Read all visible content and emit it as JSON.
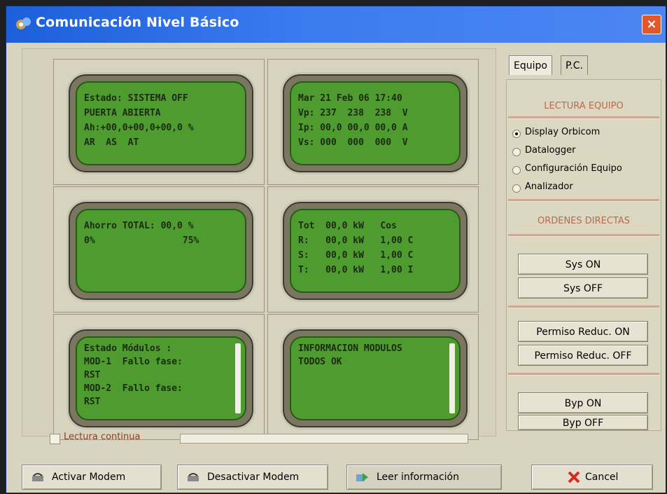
{
  "window": {
    "title": "Comunicación Nivel Básico",
    "close_glyph": "×"
  },
  "displays": [
    {
      "lines": [
        "Estado: SISTEMA OFF",
        "PUERTA ABIERTA",
        "Ah:+00,0+00,0+00,0 %",
        "AR  AS  AT"
      ]
    },
    {
      "lines": [
        "Mar 21 Feb 06 17:40",
        "Vp: 237  238  238  V",
        "Ip: 00,0 00,0 00,0 A",
        "Vs: 000  000  000  V"
      ]
    },
    {
      "lines": [
        "Ahorro TOTAL: 00,0 %",
        "0%                75%"
      ]
    },
    {
      "lines": [
        "Tot  00,0 kW   Cos",
        "R:   00,0 kW   1,00 C",
        "S:   00,0 kW   1,00 C",
        "T:   00,0 kW   1,00 I"
      ]
    },
    {
      "lines": [
        "Estado Módulos :",
        "MOD-1  Fallo fase:",
        "RST",
        "MOD-2  Fallo fase:",
        "RST"
      ]
    },
    {
      "lines": [
        "INFORMACION MODULOS",
        "TODOS OK"
      ]
    }
  ],
  "lectura_continua": {
    "label": "Lectura continua",
    "checked": false
  },
  "tabs": [
    {
      "label": "Equipo",
      "active": true
    },
    {
      "label": "P.C.",
      "active": false
    }
  ],
  "side": {
    "lectura_title": "LECTURA EQUIPO",
    "options": [
      {
        "label": "Display Orbicom",
        "selected": true
      },
      {
        "label": "Datalogger",
        "selected": false
      },
      {
        "label": "Configuración Equipo",
        "selected": false
      },
      {
        "label": "Analizador",
        "selected": false
      }
    ],
    "ordenes_title": "ORDENES DIRECTAS",
    "buttons": [
      "Sys ON",
      "Sys OFF",
      "Permiso Reduc. ON",
      "Permiso Reduc. OFF",
      "Byp ON",
      "Byp OFF"
    ]
  },
  "bottom_buttons": [
    {
      "label": "Activar Modem",
      "icon": "modem-icon"
    },
    {
      "label": "Desactivar Modem",
      "icon": "modem-icon"
    },
    {
      "label": "Leer información",
      "icon": "read-icon",
      "disabled": true
    },
    {
      "label": "Cancel",
      "icon": "x-cancel-icon"
    }
  ]
}
